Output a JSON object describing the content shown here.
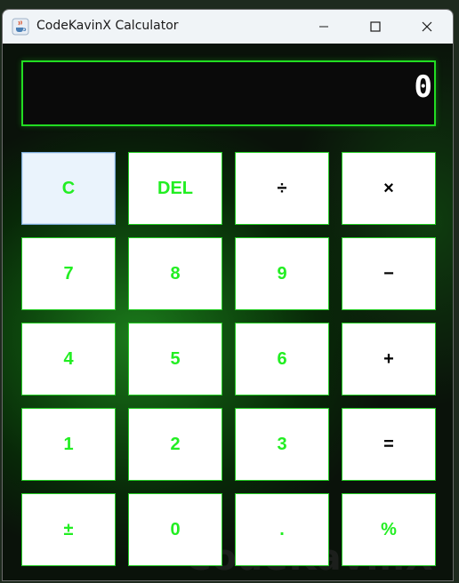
{
  "window": {
    "title": "CodeKavinX Calculator",
    "icons": {
      "app": "java-cup-icon",
      "minimize": "minimize-icon",
      "maximize": "maximize-icon",
      "close": "close-icon"
    }
  },
  "display": {
    "value": "0"
  },
  "watermark": "CodeKavinX",
  "keys": {
    "clear": "C",
    "delete": "DEL",
    "divide": "÷",
    "multiply": "×",
    "seven": "7",
    "eight": "8",
    "nine": "9",
    "subtract": "−",
    "four": "4",
    "five": "5",
    "six": "6",
    "add": "+",
    "one": "1",
    "two": "2",
    "three": "3",
    "equals": "=",
    "negate": "±",
    "zero": "0",
    "decimal": ".",
    "percent": "%"
  },
  "colors": {
    "accent_green": "#22ee22",
    "operator_text": "#000000",
    "display_border": "#22dd22",
    "key_background": "#ffffff"
  }
}
